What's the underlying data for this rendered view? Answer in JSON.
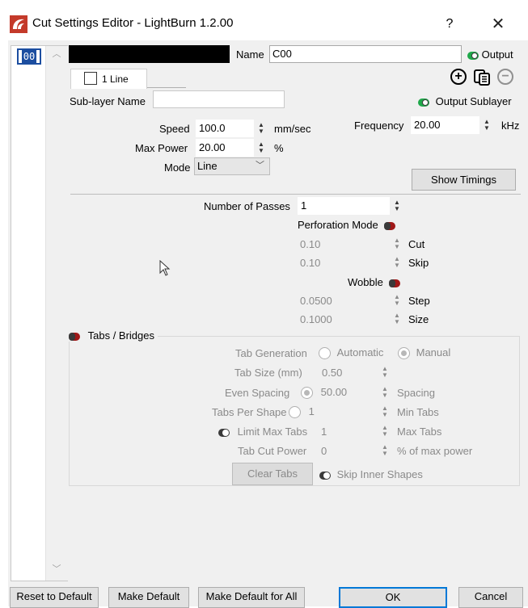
{
  "window": {
    "title": "Cut Settings Editor - LightBurn 1.2.00",
    "help": "?",
    "close": "✕"
  },
  "layer_list": {
    "items": [
      {
        "label": "00"
      }
    ],
    "scroll_up": "^",
    "scroll_down": "⌄"
  },
  "header": {
    "name_label": "Name",
    "name_value": "C00",
    "output_label": "Output",
    "tab_label": "1 Line",
    "sublayer_label": "Sub-layer Name",
    "sublayer_value": "",
    "output_sublayer_label": "Output Sublayer"
  },
  "settings": {
    "speed_label": "Speed",
    "speed_value": "100.0",
    "speed_unit": "mm/sec",
    "frequency_label": "Frequency",
    "frequency_value": "20.00",
    "frequency_unit": "kHz",
    "max_power_label": "Max Power",
    "max_power_value": "20.00",
    "max_power_unit": "%",
    "mode_label": "Mode",
    "mode_value": "Line",
    "show_timings": "Show Timings"
  },
  "passes": {
    "label": "Number of Passes",
    "value": "1",
    "perforation_label": "Perforation Mode",
    "cut_value": "0.10",
    "cut_label": "Cut",
    "skip_value": "0.10",
    "skip_label": "Skip",
    "wobble_label": "Wobble",
    "step_value": "0.0500",
    "step_label": "Step",
    "size_value": "0.1000",
    "size_label": "Size"
  },
  "tabs": {
    "group_label": "Tabs / Bridges",
    "generation_label": "Tab Generation",
    "automatic": "Automatic",
    "manual": "Manual",
    "size_label": "Tab Size (mm)",
    "size_value": "0.50",
    "even_spacing_label": "Even Spacing",
    "even_spacing_value": "50.00",
    "spacing_label": "Spacing",
    "per_shape_label": "Tabs Per Shape",
    "per_shape_value": "1",
    "min_tabs_label": "Min Tabs",
    "limit_max_label": "Limit Max Tabs",
    "limit_max_value": "1",
    "max_tabs_label": "Max Tabs",
    "cut_power_label": "Tab Cut Power",
    "cut_power_value": "0",
    "cut_power_unit": "% of max power",
    "clear_tabs": "Clear Tabs",
    "skip_inner_label": "Skip Inner Shapes"
  },
  "footer": {
    "reset": "Reset to Default",
    "make_default": "Make Default",
    "make_default_all": "Make Default for All",
    "ok": "OK",
    "cancel": "Cancel"
  },
  "colors": {
    "accent_selection": "#1c4ea0",
    "toggle_on": "#1fa84a",
    "toggle_off": "#a01818",
    "app_icon": "#c43a2a"
  }
}
